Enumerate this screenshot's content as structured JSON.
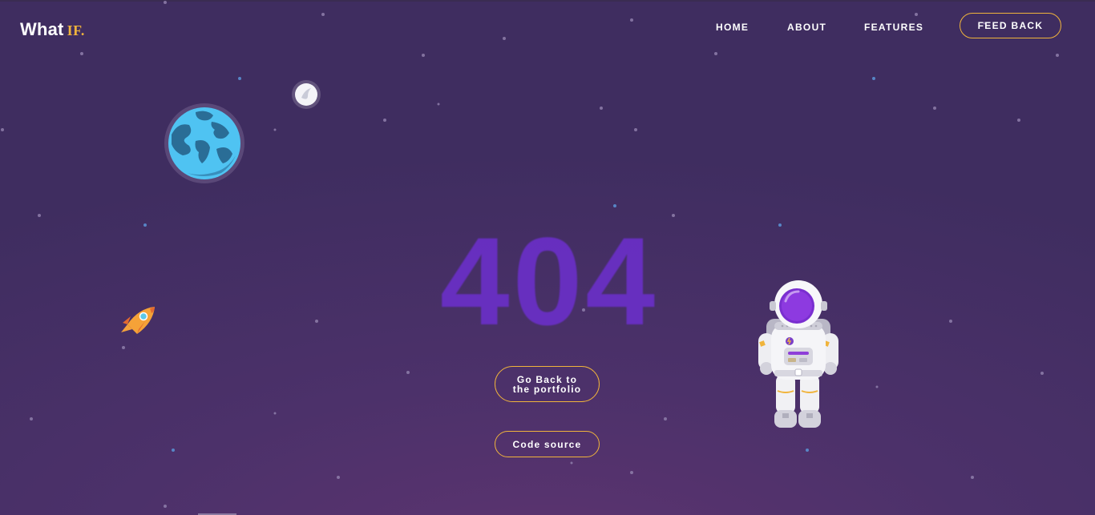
{
  "header": {
    "logo_main": "What",
    "logo_accent": "IF.",
    "nav": [
      "HOME",
      "ABOUT",
      "FEATURES"
    ],
    "feedback_label": "FEED BACK"
  },
  "main": {
    "error_code": "404",
    "back_line1": "Go Back to",
    "back_line2": "the portfolio",
    "code_label": "Code source"
  },
  "colors": {
    "accent": "#f0b43c",
    "error_text": "#6a2fc7",
    "background": "#4c316a"
  },
  "icons": [
    "earth-icon",
    "moon-icon",
    "rocket-icon",
    "astronaut-icon"
  ]
}
